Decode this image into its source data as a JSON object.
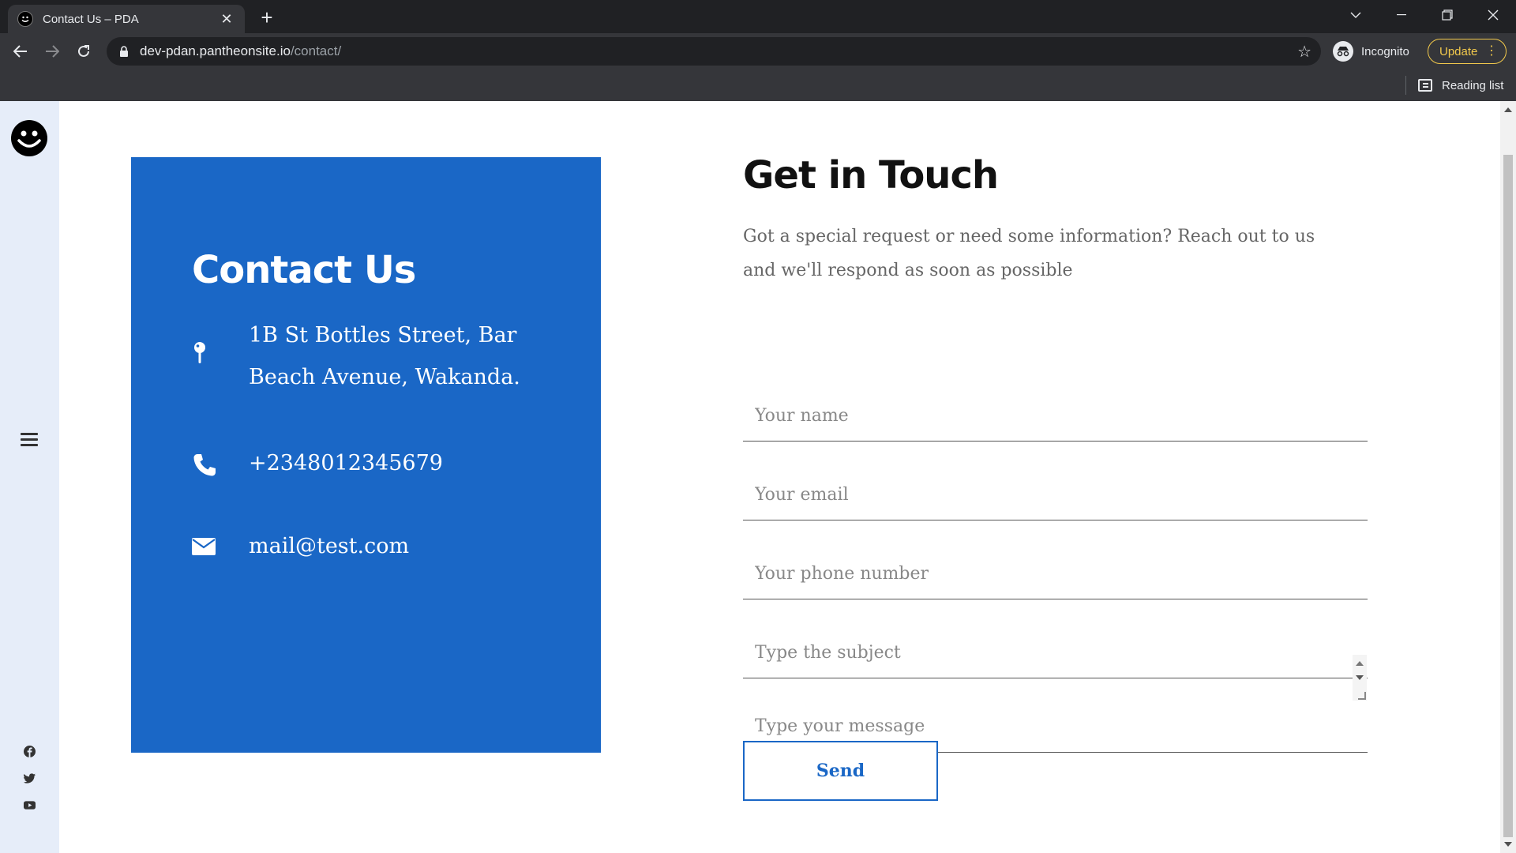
{
  "browser": {
    "tab_title": "Contact Us – PDA",
    "url_host": "dev-pdan.pantheonsite.io",
    "url_path": "/contact/",
    "incognito_label": "Incognito",
    "update_label": "Update",
    "reading_list_label": "Reading list"
  },
  "sidebar": {
    "logo": "smiley-logo",
    "menu_icon": "hamburger-icon",
    "social": [
      "facebook-icon",
      "twitter-icon",
      "youtube-icon"
    ]
  },
  "contact_card": {
    "title": "Contact Us",
    "address_line1": "1B St Bottles Street, Bar",
    "address_line2": "Beach Avenue, Wakanda.",
    "phone": "+2348012345679",
    "email": "mail@test.com",
    "background_color": "#1a67c6"
  },
  "form": {
    "title": "Get in Touch",
    "description": "Got a special request or need some information? Reach out to us and we'll respond as soon as possible",
    "name_placeholder": "Your name",
    "email_placeholder": "Your email",
    "phone_placeholder": "Your phone number",
    "subject_placeholder": "Type the subject",
    "message_placeholder": "Type your message",
    "send_label": "Send",
    "accent_color": "#1a67c6"
  }
}
